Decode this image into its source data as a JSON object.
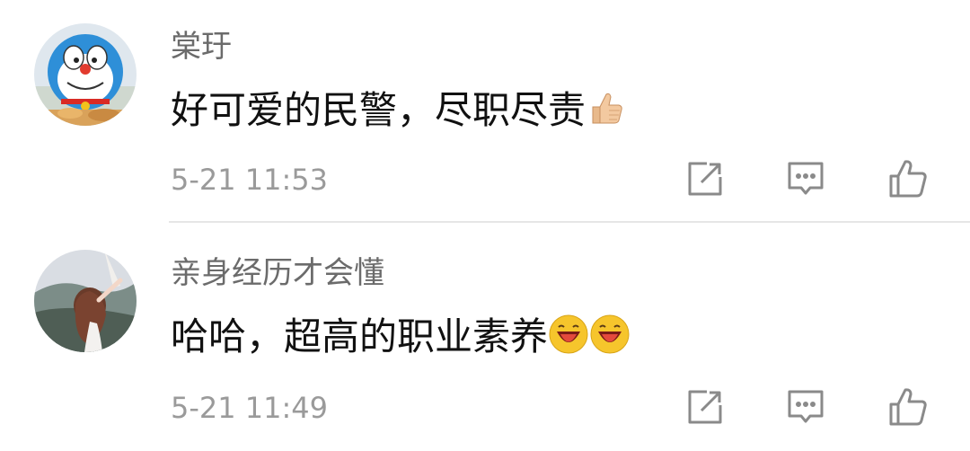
{
  "comments": [
    {
      "username": "棠玗",
      "text": "好可爱的民警，尽职尽责",
      "emojis": [
        "thumbs-up"
      ],
      "time": "5-21 11:53",
      "avatar": "doraemon-cartoon-avatar"
    },
    {
      "username": "亲身经历才会懂",
      "text": "哈哈，超高的职业素养",
      "emojis": [
        "laughing-face",
        "laughing-face"
      ],
      "time": "5-21 11:49",
      "avatar": "girl-on-hill-photo-avatar"
    }
  ],
  "icons": {
    "share": "share-icon",
    "reply": "reply-icon",
    "like": "like-icon"
  },
  "colors": {
    "username": "#6b6b6b",
    "text": "#111111",
    "time": "#9a9a9a",
    "icon": "#8a8a8a",
    "divider": "#e6e6e6"
  }
}
